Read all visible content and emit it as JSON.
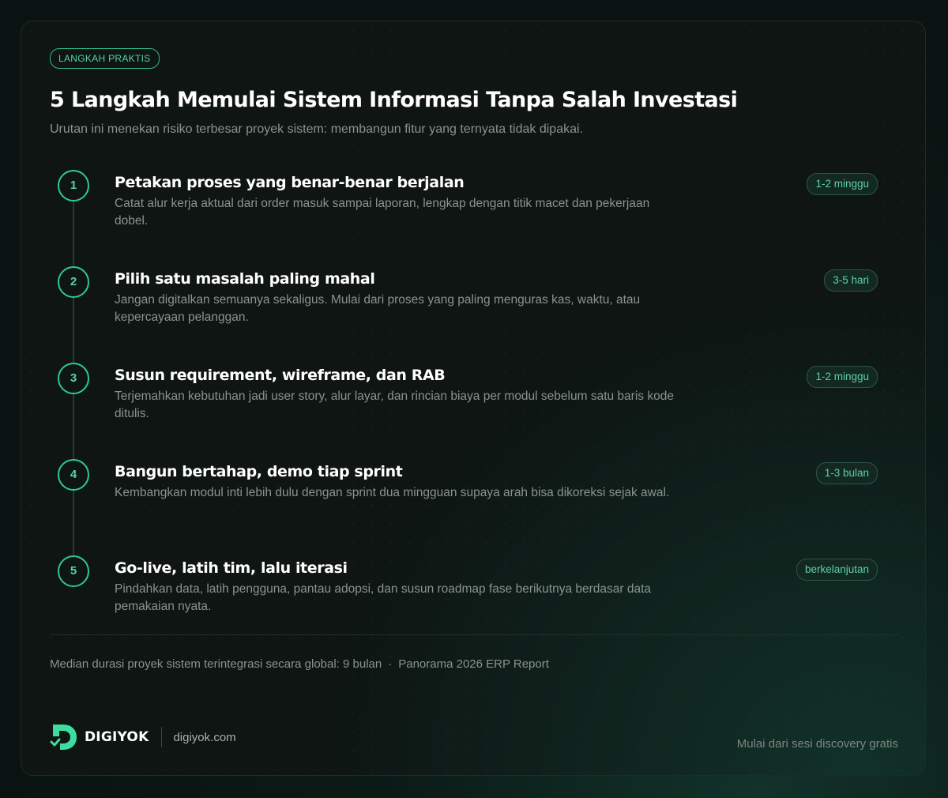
{
  "badge": "LANGKAH PRAKTIS",
  "title": "5 Langkah Memulai Sistem Informasi Tanpa Salah Investasi",
  "subtitle": "Urutan ini menekan risiko terbesar proyek sistem: membangun fitur yang ternyata tidak dipakai.",
  "steps": [
    {
      "number": "1",
      "title": "Petakan proses yang benar-benar berjalan",
      "description": "Catat alur kerja aktual dari order masuk sampai laporan, lengkap dengan titik macet dan pekerjaan dobel.",
      "duration": "1-2 minggu"
    },
    {
      "number": "2",
      "title": "Pilih satu masalah paling mahal",
      "description": "Jangan digitalkan semuanya sekaligus. Mulai dari proses yang paling menguras kas, waktu, atau kepercayaan pelanggan.",
      "duration": "3-5 hari"
    },
    {
      "number": "3",
      "title": "Susun requirement, wireframe, dan RAB",
      "description": "Terjemahkan kebutuhan jadi user story, alur layar, dan rincian biaya per modul sebelum satu baris kode ditulis.",
      "duration": "1-2 minggu"
    },
    {
      "number": "4",
      "title": "Bangun bertahap, demo tiap sprint",
      "description": "Kembangkan modul inti lebih dulu dengan sprint dua mingguan supaya arah bisa dikoreksi sejak awal.",
      "duration": "1-3 bulan"
    },
    {
      "number": "5",
      "title": "Go-live, latih tim, lalu iterasi",
      "description": "Pindahkan data, latih pengguna, pantau adopsi, dan susun roadmap fase berikutnya berdasar data pemakaian nyata.",
      "duration": "berkelanjutan"
    }
  ],
  "footnote": {
    "stat": "Median durasi proyek sistem terintegrasi secara global: 9 bulan",
    "separator": "·",
    "source": "Panorama 2026 ERP Report"
  },
  "brand": {
    "name": "DIGIYOK",
    "url": "digiyok.com",
    "logo_icon": "digiyok-logo-icon"
  },
  "cta": "Mulai dari sesi discovery gratis",
  "colors": {
    "accent": "#2fc79b",
    "accent_text": "#54d3a8",
    "background": "#0e1513",
    "muted_text": "#8a948f"
  }
}
